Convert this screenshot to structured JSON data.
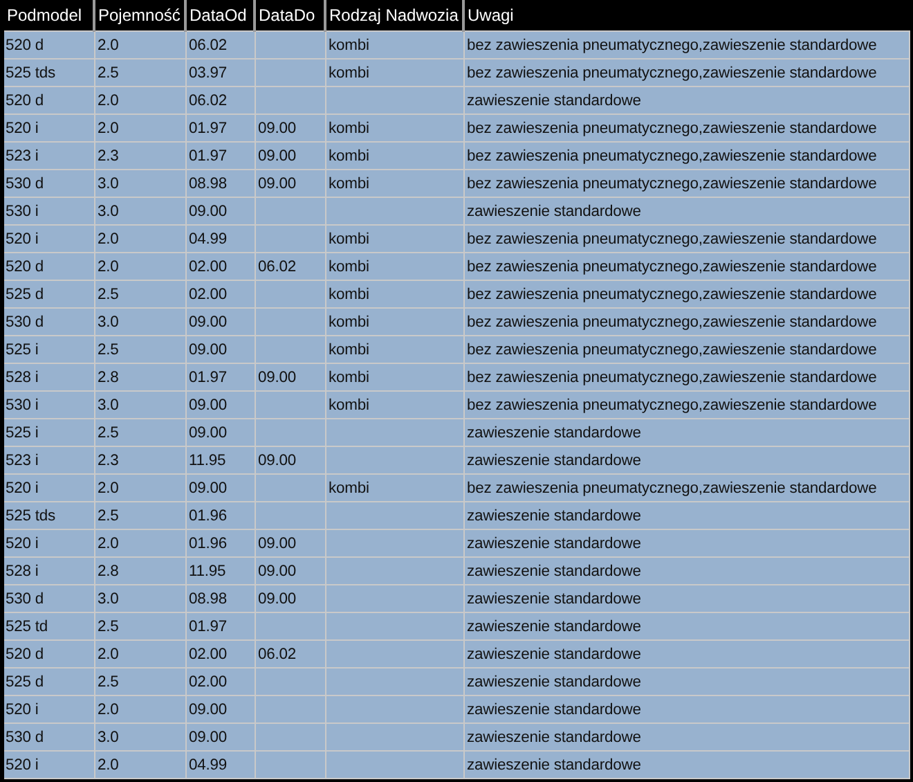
{
  "table": {
    "columns": [
      "Podmodel",
      "Pojemność",
      "DataOd",
      "DataDo",
      "Rodzaj Nadwozia",
      "Uwagi"
    ],
    "rows": [
      {
        "podmodel": "520 d",
        "pojemnosc": "2.0",
        "data_od": "06.02",
        "rodzaj_nadwozia": "kombi",
        "uwagi": "bez zawieszenia pneumatycznego,zawieszenie standardowe"
      },
      {
        "podmodel": "525 tds",
        "pojemnosc": "2.5",
        "data_od": "03.97",
        "rodzaj_nadwozia": "kombi",
        "uwagi": "bez zawieszenia pneumatycznego,zawieszenie standardowe"
      },
      {
        "podmodel": "520 d",
        "pojemnosc": "2.0",
        "data_od": "06.02",
        "uwagi": "zawieszenie standardowe"
      },
      {
        "podmodel": "520 i",
        "pojemnosc": "2.0",
        "data_od": "01.97",
        "data_do": "09.00",
        "rodzaj_nadwozia": "kombi",
        "uwagi": "bez zawieszenia pneumatycznego,zawieszenie standardowe"
      },
      {
        "podmodel": "523 i",
        "pojemnosc": "2.3",
        "data_od": "01.97",
        "data_do": "09.00",
        "rodzaj_nadwozia": "kombi",
        "uwagi": "bez zawieszenia pneumatycznego,zawieszenie standardowe"
      },
      {
        "podmodel": "530 d",
        "pojemnosc": "3.0",
        "data_od": "08.98",
        "data_do": "09.00",
        "rodzaj_nadwozia": "kombi",
        "uwagi": "bez zawieszenia pneumatycznego,zawieszenie standardowe"
      },
      {
        "podmodel": "530 i",
        "pojemnosc": "3.0",
        "data_od": "09.00",
        "uwagi": "zawieszenie standardowe"
      },
      {
        "podmodel": "520 i",
        "pojemnosc": "2.0",
        "data_od": "04.99",
        "rodzaj_nadwozia": "kombi",
        "uwagi": "bez zawieszenia pneumatycznego,zawieszenie standardowe"
      },
      {
        "podmodel": "520 d",
        "pojemnosc": "2.0",
        "data_od": "02.00",
        "data_do": "06.02",
        "rodzaj_nadwozia": "kombi",
        "uwagi": "bez zawieszenia pneumatycznego,zawieszenie standardowe"
      },
      {
        "podmodel": "525 d",
        "pojemnosc": "2.5",
        "data_od": "02.00",
        "rodzaj_nadwozia": "kombi",
        "uwagi": "bez zawieszenia pneumatycznego,zawieszenie standardowe"
      },
      {
        "podmodel": "530 d",
        "pojemnosc": "3.0",
        "data_od": "09.00",
        "rodzaj_nadwozia": "kombi",
        "uwagi": "bez zawieszenia pneumatycznego,zawieszenie standardowe"
      },
      {
        "podmodel": "525 i",
        "pojemnosc": "2.5",
        "data_od": "09.00",
        "rodzaj_nadwozia": "kombi",
        "uwagi": "bez zawieszenia pneumatycznego,zawieszenie standardowe"
      },
      {
        "podmodel": "528 i",
        "pojemnosc": "2.8",
        "data_od": "01.97",
        "data_do": "09.00",
        "rodzaj_nadwozia": "kombi",
        "uwagi": "bez zawieszenia pneumatycznego,zawieszenie standardowe"
      },
      {
        "podmodel": "530 i",
        "pojemnosc": "3.0",
        "data_od": "09.00",
        "rodzaj_nadwozia": "kombi",
        "uwagi": "bez zawieszenia pneumatycznego,zawieszenie standardowe"
      },
      {
        "podmodel": "525 i",
        "pojemnosc": "2.5",
        "data_od": "09.00",
        "uwagi": "zawieszenie standardowe"
      },
      {
        "podmodel": "523 i",
        "pojemnosc": "2.3",
        "data_od": "11.95",
        "data_do": "09.00",
        "uwagi": "zawieszenie standardowe"
      },
      {
        "podmodel": "520 i",
        "pojemnosc": "2.0",
        "data_od": "09.00",
        "rodzaj_nadwozia": "kombi",
        "uwagi": "bez zawieszenia pneumatycznego,zawieszenie standardowe"
      },
      {
        "podmodel": "525 tds",
        "pojemnosc": "2.5",
        "data_od": "01.96",
        "uwagi": "zawieszenie standardowe"
      },
      {
        "podmodel": "520 i",
        "pojemnosc": "2.0",
        "data_od": "01.96",
        "data_do": "09.00",
        "uwagi": "zawieszenie standardowe"
      },
      {
        "podmodel": "528 i",
        "pojemnosc": "2.8",
        "data_od": "11.95",
        "data_do": "09.00",
        "uwagi": "zawieszenie standardowe"
      },
      {
        "podmodel": "530 d",
        "pojemnosc": "3.0",
        "data_od": "08.98",
        "data_do": "09.00",
        "uwagi": "zawieszenie standardowe"
      },
      {
        "podmodel": "525 td",
        "pojemnosc": "2.5",
        "data_od": "01.97",
        "uwagi": "zawieszenie standardowe"
      },
      {
        "podmodel": "520 d",
        "pojemnosc": "2.0",
        "data_od": "02.00",
        "data_do": "06.02",
        "uwagi": "zawieszenie standardowe"
      },
      {
        "podmodel": "525 d",
        "pojemnosc": "2.5",
        "data_od": "02.00",
        "uwagi": "zawieszenie standardowe"
      },
      {
        "podmodel": "520 i",
        "pojemnosc": "2.0",
        "data_od": "09.00",
        "uwagi": "zawieszenie standardowe"
      },
      {
        "podmodel": "530 d",
        "pojemnosc": "3.0",
        "data_od": "09.00",
        "uwagi": "zawieszenie standardowe"
      },
      {
        "podmodel": "520 i",
        "pojemnosc": "2.0",
        "data_od": "04.99",
        "uwagi": "zawieszenie standardowe"
      }
    ]
  }
}
